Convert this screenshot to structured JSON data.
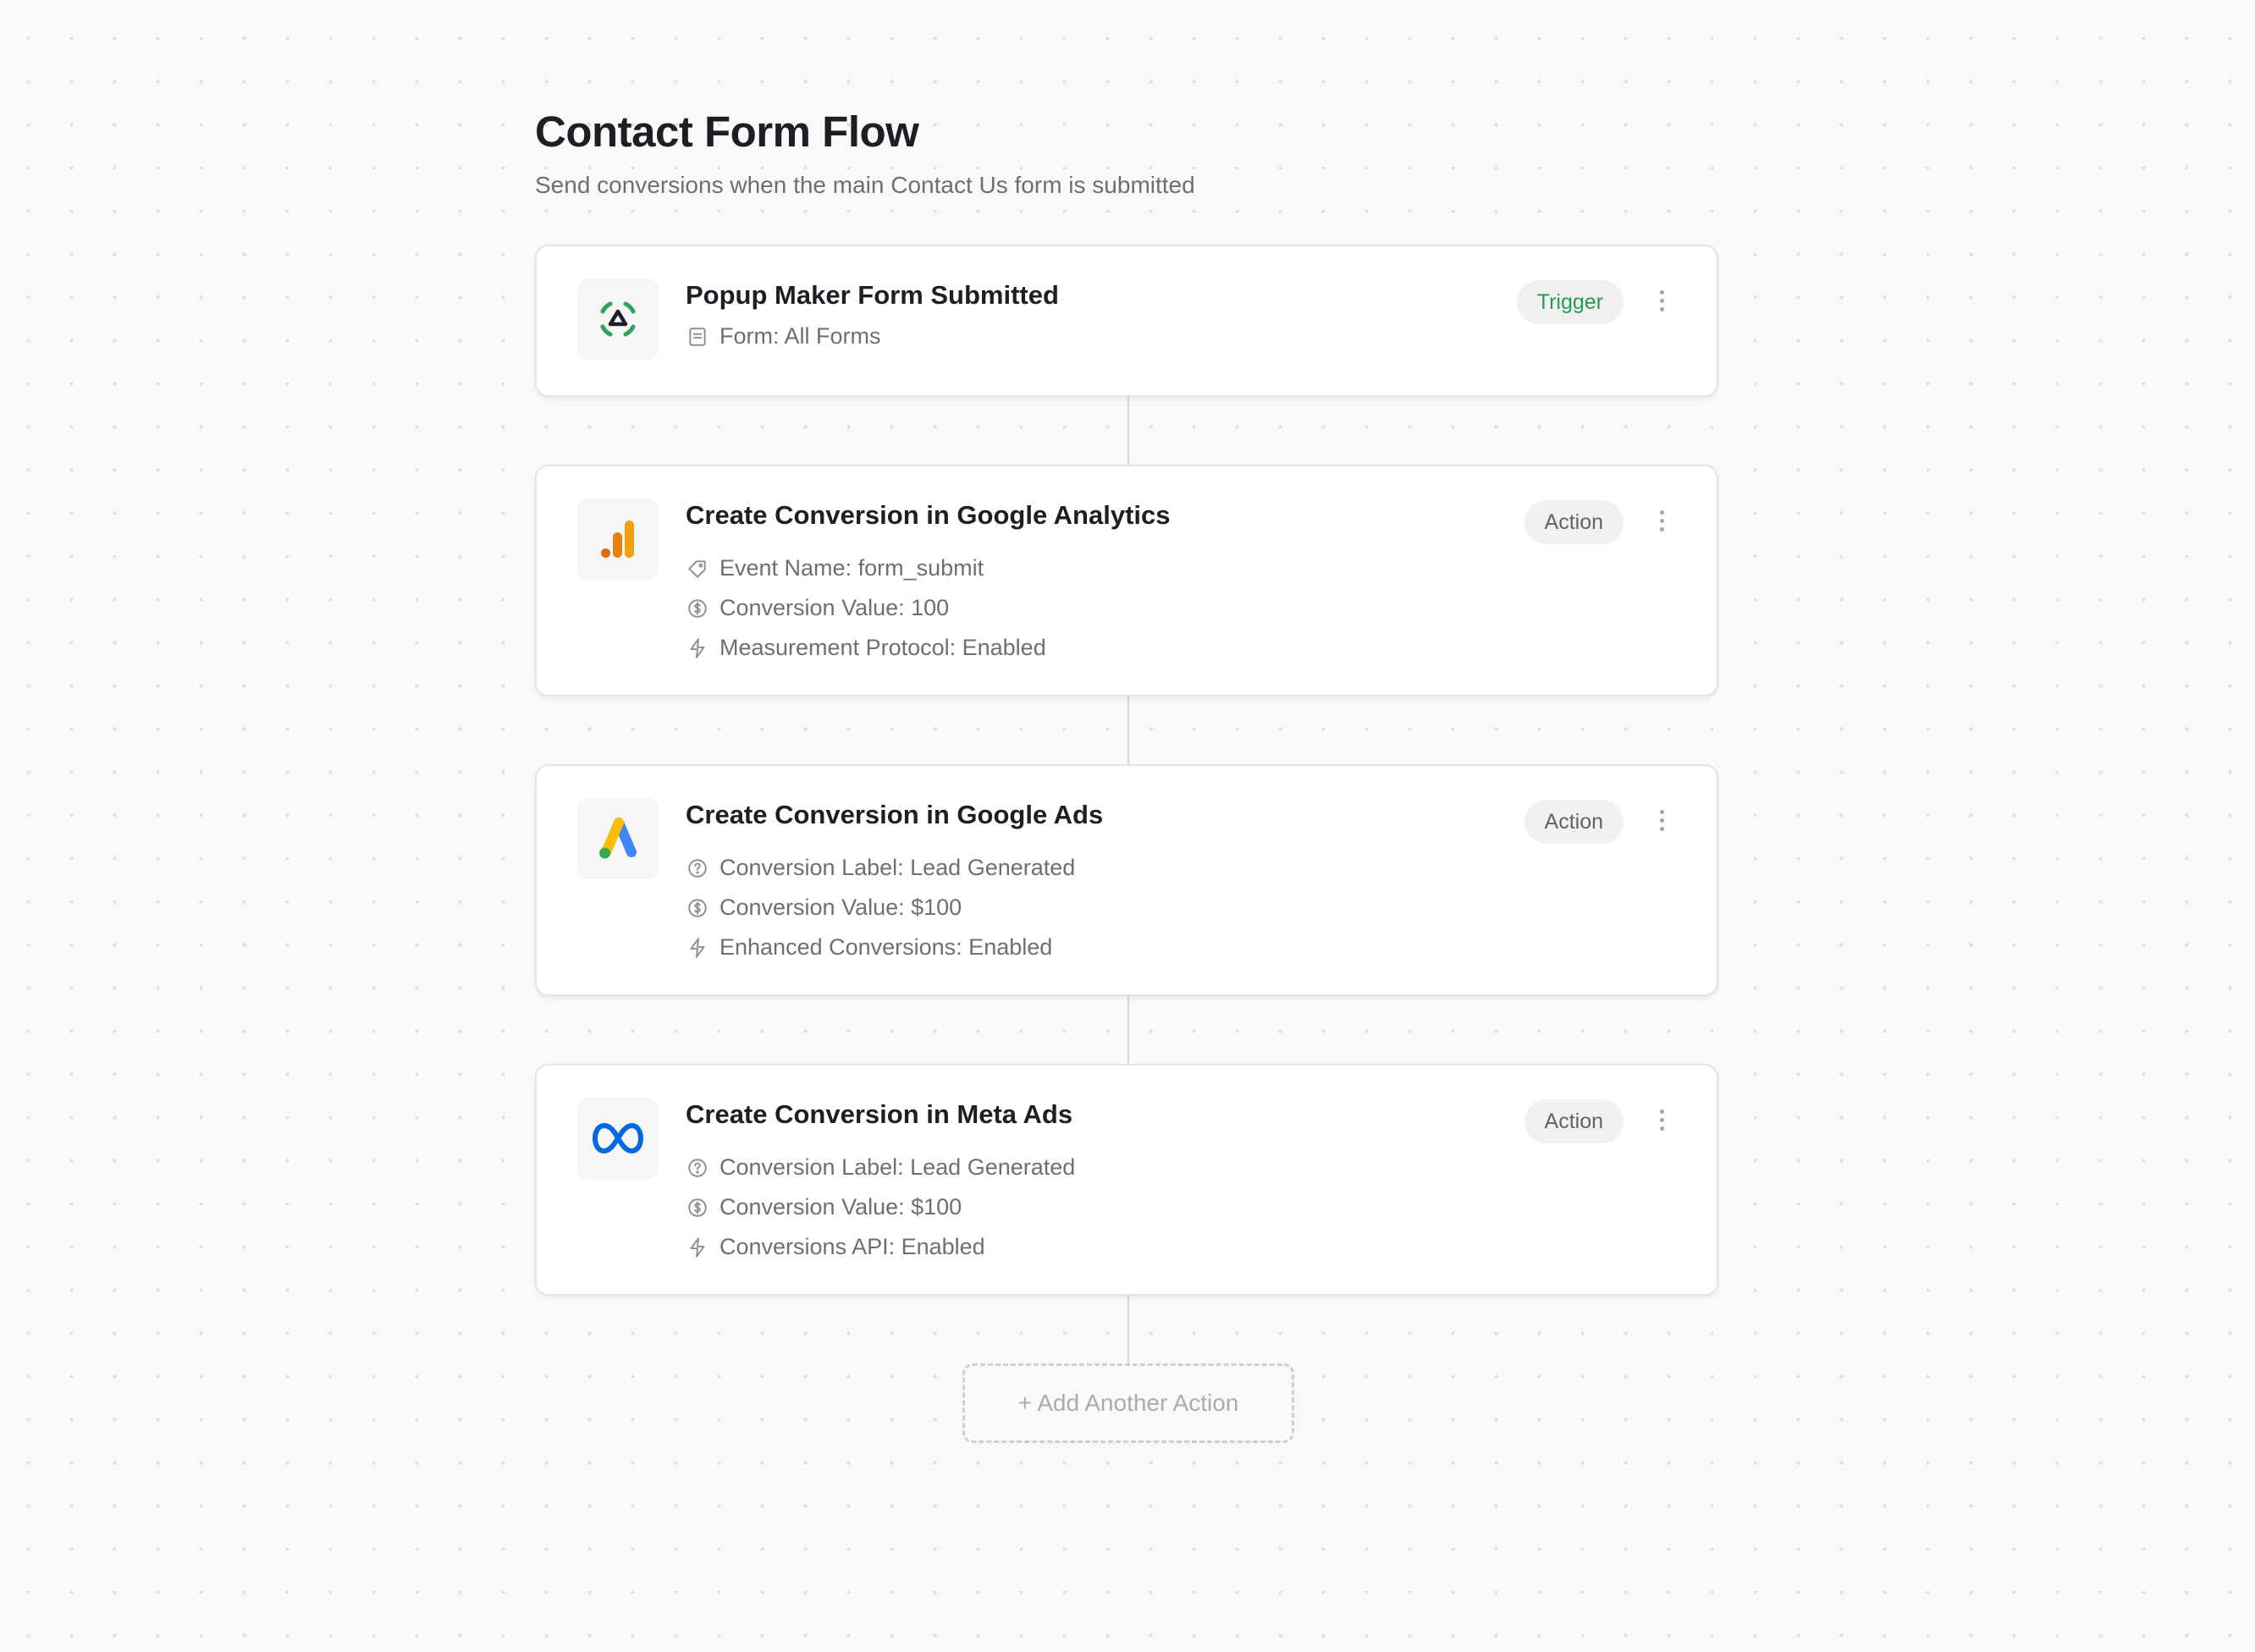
{
  "flow": {
    "title": "Contact Form Flow",
    "subtitle": "Send conversions when the main Contact Us form is submitted"
  },
  "steps": [
    {
      "title": "Popup Maker Form Submitted",
      "badge": "Trigger",
      "logo": "popup-maker-logo",
      "details": [
        {
          "icon": "form-icon",
          "text": "Form: All Forms"
        }
      ]
    },
    {
      "title": "Create Conversion in Google Analytics",
      "badge": "Action",
      "logo": "google-analytics-logo",
      "details": [
        {
          "icon": "tag-icon",
          "text": "Event Name: form_submit"
        },
        {
          "icon": "dollar-circle-icon",
          "text": "Conversion Value: 100"
        },
        {
          "icon": "lightning-icon",
          "text": "Measurement Protocol: Enabled"
        }
      ]
    },
    {
      "title": "Create Conversion in Google Ads",
      "badge": "Action",
      "logo": "google-ads-logo",
      "details": [
        {
          "icon": "help-circle-icon",
          "text": "Conversion Label: Lead Generated"
        },
        {
          "icon": "dollar-circle-icon",
          "text": "Conversion Value: $100"
        },
        {
          "icon": "lightning-icon",
          "text": "Enhanced Conversions: Enabled"
        }
      ]
    },
    {
      "title": "Create Conversion in Meta Ads",
      "badge": "Action",
      "logo": "meta-logo",
      "details": [
        {
          "icon": "help-circle-icon",
          "text": "Conversion Label: Lead Generated"
        },
        {
          "icon": "dollar-circle-icon",
          "text": "Conversion Value: $100"
        },
        {
          "icon": "lightning-icon",
          "text": "Conversions API: Enabled"
        }
      ]
    }
  ],
  "add_button": {
    "label": "+ Add Another Action"
  },
  "colors": {
    "trigger_badge_text": "#2a9a52",
    "popup_maker_green": "#2ea35a",
    "google_analytics_orange": "#f4a00c",
    "google_analytics_dark_orange": "#e06a12",
    "google_ads_blue": "#4285f4",
    "google_ads_yellow": "#fbbc04",
    "google_ads_green": "#34a853",
    "meta_blue": "#0668e1"
  }
}
